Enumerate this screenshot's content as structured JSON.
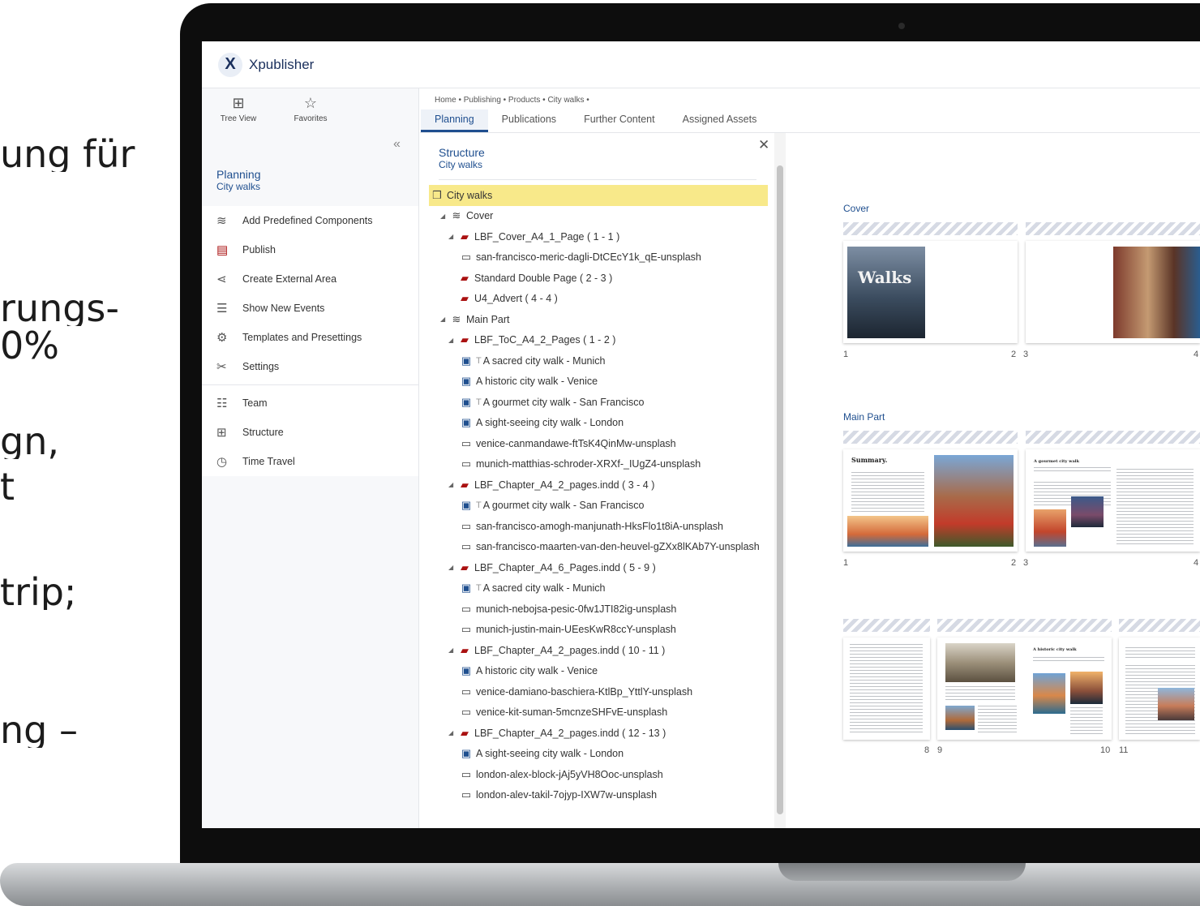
{
  "background_text": [
    "ung für",
    "rungs-",
    "0%",
    "gn,",
    "t",
    "trip;",
    "ng –"
  ],
  "app": {
    "name": "Xpublisher",
    "logo_letter": "X"
  },
  "sidebar": {
    "quick": [
      {
        "label": "Tree View",
        "icon": "tree-view-icon"
      },
      {
        "label": "Favorites",
        "icon": "star-icon"
      }
    ],
    "title": "Planning",
    "subtitle": "City walks",
    "menu": [
      {
        "label": "Add Predefined Components",
        "icon": "layers-add-icon"
      },
      {
        "label": "Publish",
        "icon": "pdf-icon"
      },
      {
        "label": "Create External Area",
        "icon": "share-nodes-icon"
      },
      {
        "label": "Show New Events",
        "icon": "events-list-icon"
      },
      {
        "label": "Templates and Presettings",
        "icon": "gear-icon"
      },
      {
        "label": "Settings",
        "icon": "tools-icon"
      }
    ],
    "menu2": [
      {
        "label": "Team",
        "icon": "team-icon"
      },
      {
        "label": "Structure",
        "icon": "structure-icon"
      },
      {
        "label": "Time Travel",
        "icon": "clock-icon"
      }
    ]
  },
  "breadcrumb": "Home  •  Publishing  •  Products  •  City walks  •",
  "tabs": [
    {
      "label": "Planning",
      "active": true
    },
    {
      "label": "Publications",
      "active": false
    },
    {
      "label": "Further Content",
      "active": false
    },
    {
      "label": "Assigned Assets",
      "active": false
    }
  ],
  "structure": {
    "title": "Structure",
    "subtitle": "City walks",
    "rows": [
      {
        "level": 0,
        "type": "book",
        "label": "City walks",
        "selected": true
      },
      {
        "level": 1,
        "type": "layers",
        "label": "Cover"
      },
      {
        "level": 2,
        "type": "pdf",
        "label": "LBF_Cover_A4_1_Page ( 1 - 1 )"
      },
      {
        "level": 3,
        "type": "image",
        "label": "san-francisco-meric-dagli-DtCEcY1k_qE-unsplash"
      },
      {
        "level": 2,
        "type": "pdf",
        "label": "Standard Double Page ( 2 - 3 )"
      },
      {
        "level": 2,
        "type": "pdf",
        "label": "U4_Advert ( 4 - 4 )"
      },
      {
        "level": 1,
        "type": "layers",
        "label": "Main Part"
      },
      {
        "level": 2,
        "type": "pdf",
        "label": "LBF_ToC_A4_2_Pages ( 1 - 2 )"
      },
      {
        "level": 3,
        "type": "doc",
        "label": "A sacred city walk - Munich",
        "prefix": "T"
      },
      {
        "level": 3,
        "type": "doc",
        "label": "A historic city walk - Venice"
      },
      {
        "level": 3,
        "type": "doc",
        "label": "A gourmet city walk - San Francisco",
        "prefix": "T"
      },
      {
        "level": 3,
        "type": "doc",
        "label": "A sight-seeing city walk - London"
      },
      {
        "level": 3,
        "type": "image",
        "label": "venice-canmandawe-ftTsK4QinMw-unsplash"
      },
      {
        "level": 3,
        "type": "image",
        "label": "munich-matthias-schroder-XRXf-_IUgZ4-unsplash"
      },
      {
        "level": 2,
        "type": "pdf",
        "label": "LBF_Chapter_A4_2_pages.indd ( 3 - 4 )"
      },
      {
        "level": 3,
        "type": "doc",
        "label": "A gourmet city walk - San Francisco",
        "prefix": "T"
      },
      {
        "level": 3,
        "type": "image",
        "label": "san-francisco-amogh-manjunath-HksFlo1t8iA-unsplash"
      },
      {
        "level": 3,
        "type": "image",
        "label": "san-francisco-maarten-van-den-heuvel-gZXx8lKAb7Y-unsplash"
      },
      {
        "level": 2,
        "type": "pdf",
        "label": "LBF_Chapter_A4_6_Pages.indd ( 5 - 9 )"
      },
      {
        "level": 3,
        "type": "doc",
        "label": "A sacred city walk - Munich",
        "prefix": "T"
      },
      {
        "level": 3,
        "type": "image",
        "label": "munich-nebojsa-pesic-0fw1JTI82ig-unsplash"
      },
      {
        "level": 3,
        "type": "image",
        "label": "munich-justin-main-UEesKwR8ccY-unsplash"
      },
      {
        "level": 2,
        "type": "pdf",
        "label": "LBF_Chapter_A4_2_pages.indd ( 10 - 11 )"
      },
      {
        "level": 3,
        "type": "doc",
        "label": "A historic city walk - Venice"
      },
      {
        "level": 3,
        "type": "image",
        "label": "venice-damiano-baschiera-KtlBp_YttlY-unsplash"
      },
      {
        "level": 3,
        "type": "image",
        "label": "venice-kit-suman-5mcnzeSHFvE-unsplash"
      },
      {
        "level": 2,
        "type": "pdf",
        "label": "LBF_Chapter_A4_2_pages.indd ( 12 - 13 )"
      },
      {
        "level": 3,
        "type": "doc",
        "label": "A sight-seeing city walk - London"
      },
      {
        "level": 3,
        "type": "image",
        "label": "london-alex-block-jAj5yVH8Ooc-unsplash"
      },
      {
        "level": 3,
        "type": "image",
        "label": "london-alev-takil-7ojyp-IXW7w-unsplash"
      }
    ]
  },
  "preview": {
    "cover_label": "Cover",
    "main_label": "Main Part",
    "cover_title": "Walks",
    "summary_title": "Summary.",
    "gourmet_title": "A gourmet city walk",
    "historic_title": "A historic city walk",
    "cover_pages": [
      "1",
      "2",
      "3",
      "4"
    ],
    "main_pages": [
      "1",
      "2",
      "3",
      "4"
    ],
    "main_pages_row2": [
      "8",
      "9",
      "10",
      "11"
    ]
  },
  "colors": {
    "accent": "#1f4f8f",
    "selected_row": "#f8e98a",
    "pdf": "#a11111"
  }
}
